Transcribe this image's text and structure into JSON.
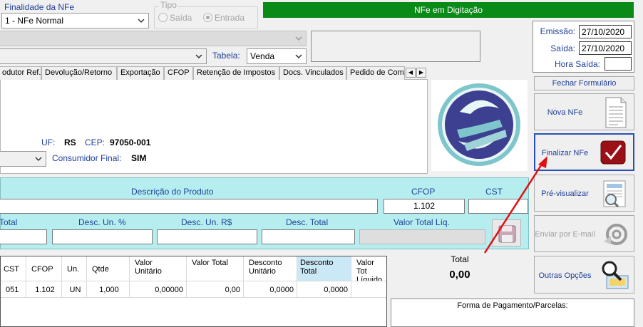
{
  "top": {
    "finalidade_label": "Finalidade da NFe",
    "finalidade_value": "1 - NFe Normal",
    "tipo_label": "Tipo",
    "tipo_saida": "Saída",
    "tipo_entrada": "Entrada",
    "status": "NFe em Digitação",
    "tabela_label": "Tabela:",
    "tabela_value": "Venda"
  },
  "dates": {
    "emissao_label": "Emissão:",
    "emissao_value": "27/10/2020",
    "saida_label": "Saída:",
    "saida_value": "27/10/2020",
    "hora_label": "Hora Saída:",
    "hora_value": ""
  },
  "tabs": [
    "odutor Ref.",
    "Devolução/Retorno",
    "Exportação",
    "CFOP",
    "Retenção de Impostos",
    "Docs. Vinculados",
    "Pedido de Comp"
  ],
  "customer": {
    "uf_label": "UF:",
    "uf_value": "RS",
    "cep_label": "CEP:",
    "cep_value": "97050-001",
    "consumidor_label": "Consumidor Final:",
    "consumidor_value": "SIM"
  },
  "buttons": {
    "fechar": "Fechar Formulário",
    "nova": "Nova NFe",
    "finalizar": "Finalizar NFe",
    "previsualizar": "Pré-visualizar",
    "email": "Enviar por E-mail",
    "outras": "Outras Opções"
  },
  "item_form": {
    "descricao_label": "Descrição do Produto",
    "cfop_label": "CFOP",
    "cfop_value": "1.102",
    "cst_label": "CST",
    "total_label": "Total",
    "desc_un_pct_label": "Desc. Un. %",
    "desc_un_rs_label": "Desc. Un. R$",
    "desc_total_label": "Desc. Total",
    "valor_liq_label": "Valor Total Líq."
  },
  "grid": {
    "headers": [
      "CST",
      "CFOP",
      "Un.",
      "Qtde",
      "Valor Unitário",
      "Valor Total",
      "Desconto Unitário",
      "Desconto Total",
      "Valor Tot Líquido"
    ],
    "rows": [
      [
        "051",
        "1.102",
        "UN",
        "1,000",
        "0,00000",
        "0,00",
        "0,0000",
        "0,0000",
        ""
      ]
    ]
  },
  "totals": {
    "label": "Total",
    "value": "0,00"
  },
  "payment": {
    "label": "Forma de Pagamento/Parcelas:"
  },
  "colors": {
    "status_bar": "#0a8a16",
    "item_panel": "#b6eef0",
    "label_blue": "#1f3f9a",
    "annotation_arrow": "#e01010"
  }
}
